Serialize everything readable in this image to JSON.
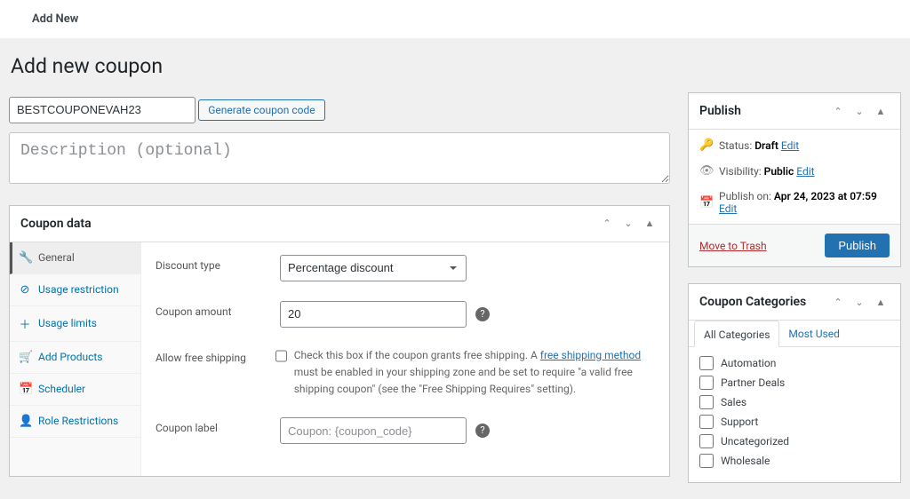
{
  "top_bar": {
    "title": "Add New"
  },
  "page": {
    "title": "Add new coupon"
  },
  "form": {
    "coupon_code": "BESTCOUPONEVAH23",
    "generate_btn": "Generate coupon code",
    "description_placeholder": "Description (optional)"
  },
  "coupon_data": {
    "title": "Coupon data",
    "tabs": [
      {
        "icon": "🔧",
        "label": "General"
      },
      {
        "icon": "⊘",
        "label": "Usage restriction"
      },
      {
        "icon": "＋",
        "label": "Usage limits"
      },
      {
        "icon": "🛒",
        "label": "Add Products"
      },
      {
        "icon": "📅",
        "label": "Scheduler"
      },
      {
        "icon": "👤",
        "label": "Role Restrictions"
      }
    ],
    "fields": {
      "discount_type_label": "Discount type",
      "discount_type_value": "Percentage discount",
      "amount_label": "Coupon amount",
      "amount_value": "20",
      "free_ship_label": "Allow free shipping",
      "free_ship_hint_pre": "Check this box if the coupon grants free shipping. A ",
      "free_ship_link": "free shipping method",
      "free_ship_hint_post": " must be enabled in your shipping zone and be set to require \"a valid free shipping coupon\" (see the \"Free Shipping Requires\" setting).",
      "coupon_label_label": "Coupon label",
      "coupon_label_placeholder": "Coupon: {coupon_code}"
    }
  },
  "publish": {
    "title": "Publish",
    "status_label": "Status:",
    "status_value": "Draft",
    "visibility_label": "Visibility:",
    "visibility_value": "Public",
    "publish_on_label": "Publish on:",
    "publish_on_value": "Apr 24, 2023 at 07:59",
    "edit": "Edit",
    "trash": "Move to Trash",
    "publish_btn": "Publish"
  },
  "categories": {
    "title": "Coupon Categories",
    "tab_all": "All Categories",
    "tab_used": "Most Used",
    "items": [
      "Automation",
      "Partner Deals",
      "Sales",
      "Support",
      "Uncategorized",
      "Wholesale"
    ]
  }
}
